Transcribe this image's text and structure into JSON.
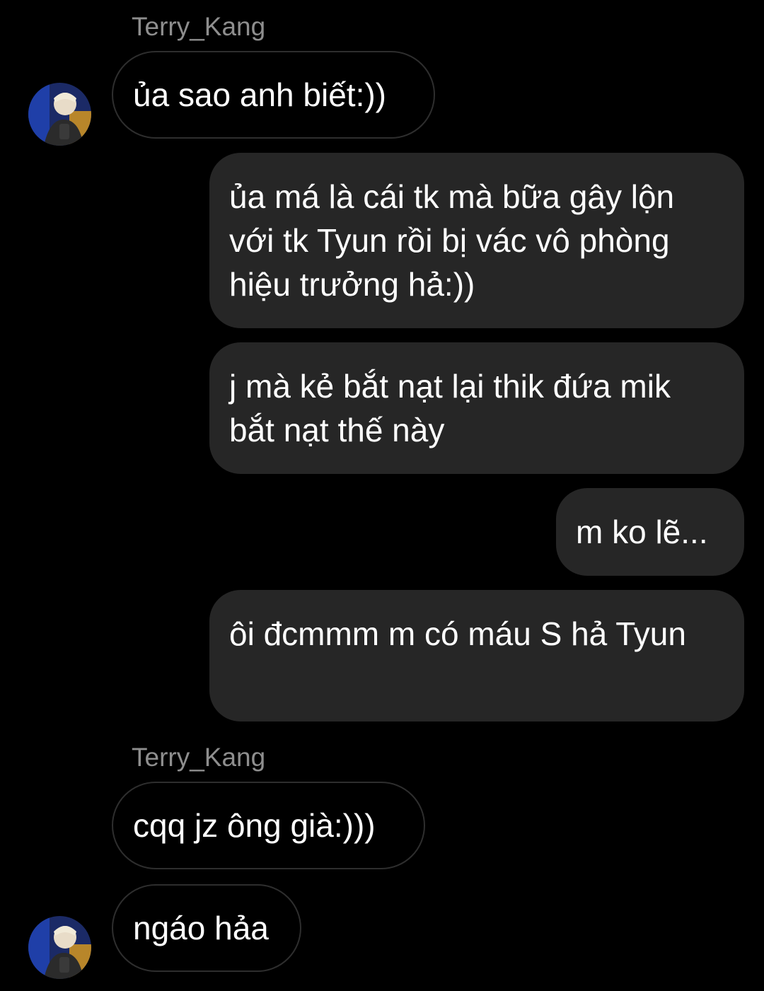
{
  "conversation": {
    "sender_1": "Terry_Kang",
    "msg_1": "ủa sao anh biết:))",
    "msg_2": "ủa má là cái tk mà bữa gây lộn với tk Tyun rồi bị vác vô phòng hiệu trưởng hả:))",
    "msg_3": "j mà kẻ bắt nạt lại thik đứa mik bắt nạt thế này",
    "msg_4": "m ko lẽ...",
    "msg_5": "ôi đcmmm m có máu S hả Tyun",
    "sender_2": "Terry_Kang",
    "msg_6": "cqq jz ông già:)))",
    "msg_7": "ngáo hảa"
  },
  "colors": {
    "background": "#000000",
    "outgoing_bubble": "#262626",
    "incoming_border": "#2e2e2e",
    "sender_name": "#8e8e8e"
  },
  "icons": {
    "avatar": "user-avatar-photo"
  }
}
